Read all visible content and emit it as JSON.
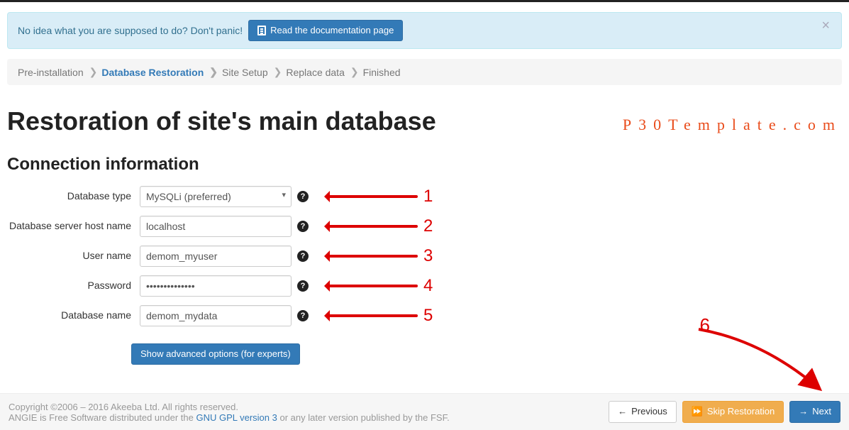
{
  "alert": {
    "text": "No idea what you are supposed to do? Don't panic!",
    "button_label": "Read the documentation page"
  },
  "breadcrumb": {
    "steps": [
      {
        "label": "Pre-installation",
        "active": false
      },
      {
        "label": "Database Restoration",
        "active": true
      },
      {
        "label": "Site Setup",
        "active": false
      },
      {
        "label": "Replace data",
        "active": false
      },
      {
        "label": "Finished",
        "active": false
      }
    ]
  },
  "page": {
    "title": "Restoration of site's main database",
    "watermark": "P30Template.com",
    "subtitle": "Connection information"
  },
  "fields": {
    "db_type": {
      "label": "Database type",
      "value": "MySQLi (preferred)"
    },
    "host": {
      "label": "Database server host name",
      "value": "localhost"
    },
    "user": {
      "label": "User name",
      "value": "demom_myuser"
    },
    "password": {
      "label": "Password",
      "value": "••••••••••••••"
    },
    "dbname": {
      "label": "Database name",
      "value": "demom_mydata"
    }
  },
  "annotations": {
    "n1": "1",
    "n2": "2",
    "n3": "3",
    "n4": "4",
    "n5": "5",
    "n6": "6"
  },
  "advanced": {
    "button_label": "Show advanced options (for experts)"
  },
  "footer": {
    "line1": "Copyright ©2006 – 2016 Akeeba Ltd. All rights reserved.",
    "line2a": "ANGIE is Free Software distributed under the ",
    "link": "GNU GPL version 3",
    "line2b": " or any later version published by the FSF.",
    "previous": "Previous",
    "skip": "Skip Restoration",
    "next": "Next"
  }
}
